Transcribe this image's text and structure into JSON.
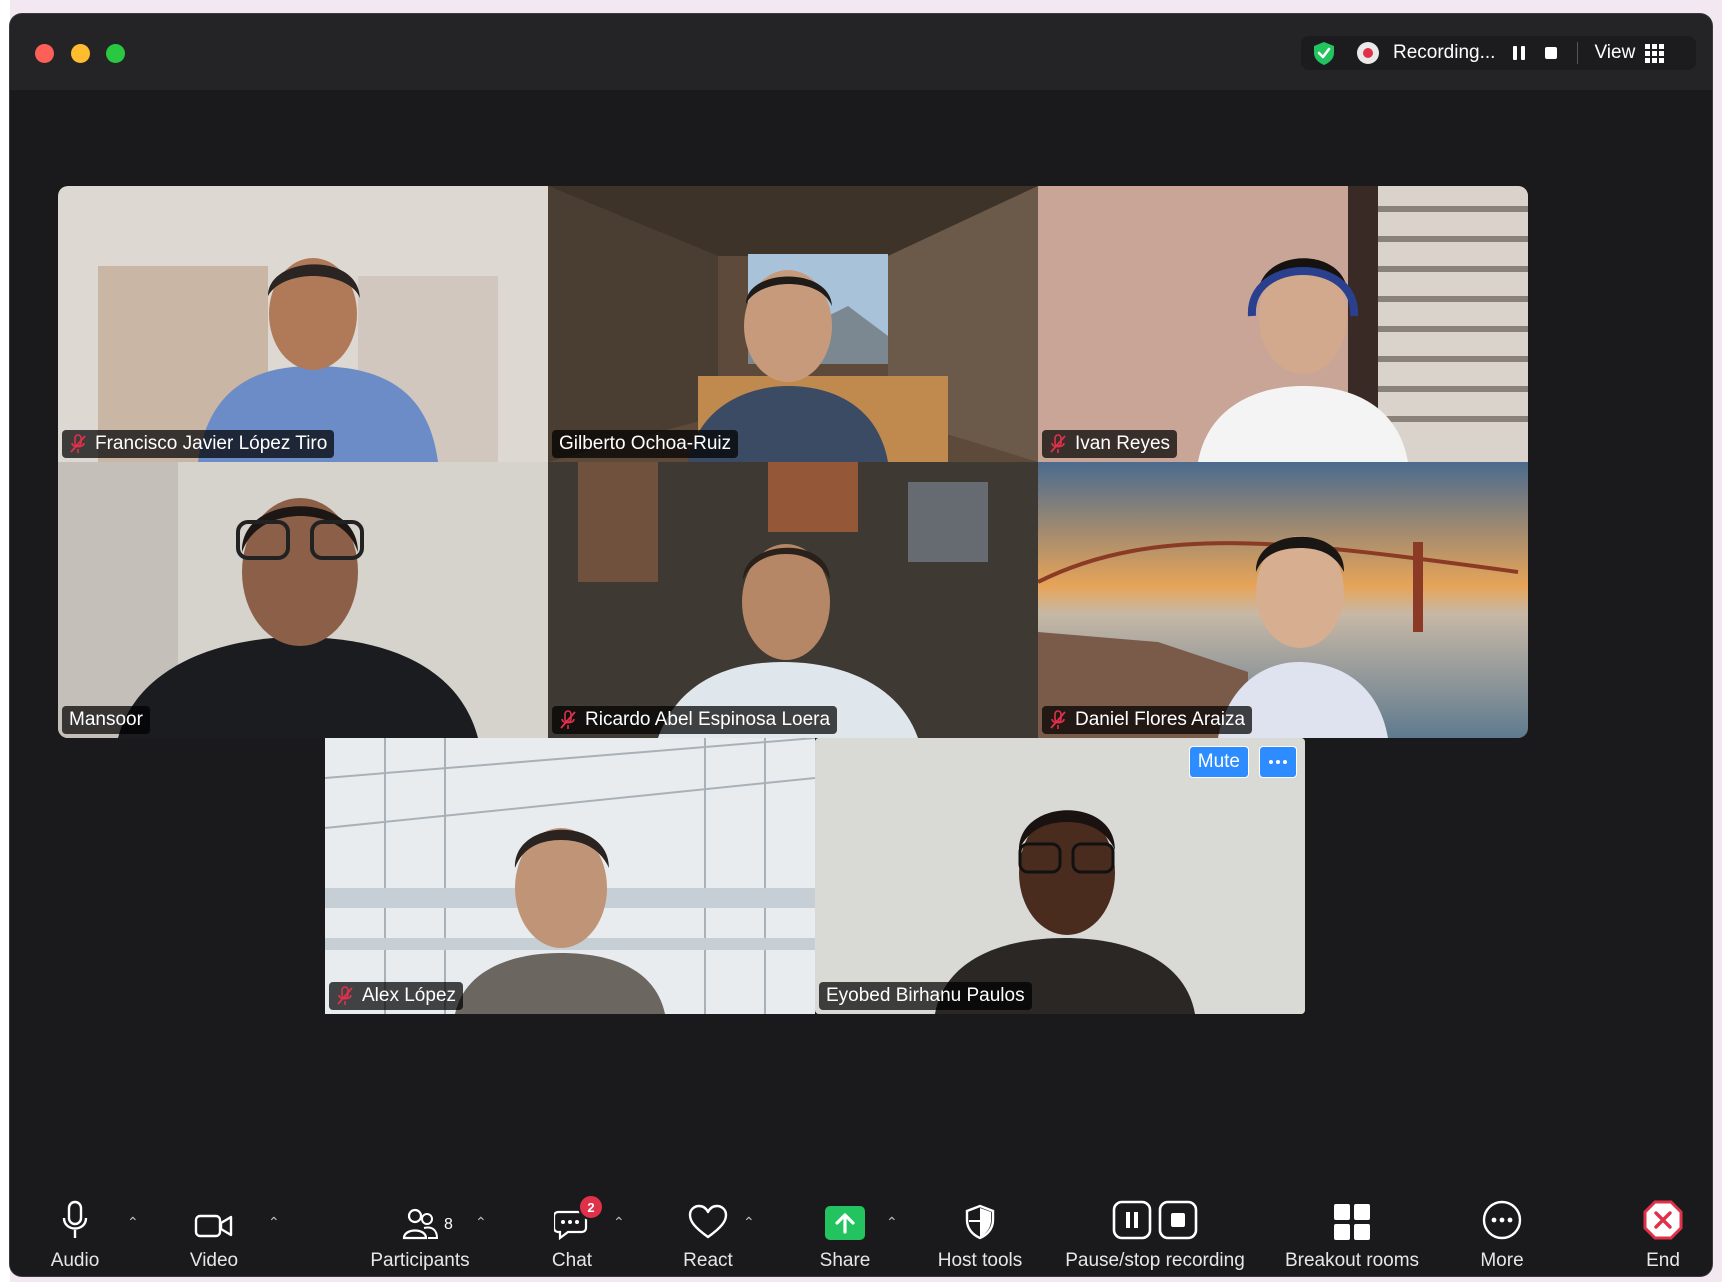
{
  "topbar": {
    "recording_label": "Recording...",
    "view_label": "View"
  },
  "participants": [
    {
      "name": "Francisco Javier López Tiro",
      "muted": true
    },
    {
      "name": "Gilberto Ochoa-Ruiz",
      "muted": false
    },
    {
      "name": "Ivan Reyes",
      "muted": true
    },
    {
      "name": "Mansoor",
      "muted": false
    },
    {
      "name": "Ricardo Abel Espinosa Loera",
      "muted": true
    },
    {
      "name": "Daniel Flores Araiza",
      "muted": true
    },
    {
      "name": "Alex López",
      "muted": true
    },
    {
      "name": "Eyobed Birhanu Paulos",
      "muted": false,
      "active_speaker": true
    }
  ],
  "active_tile": {
    "mute_label": "Mute"
  },
  "toolbar": {
    "audio": "Audio",
    "video": "Video",
    "participants": "Participants",
    "participants_count": "8",
    "chat": "Chat",
    "chat_badge": "2",
    "react": "React",
    "share": "Share",
    "host_tools": "Host tools",
    "pause_stop_recording": "Pause/stop recording",
    "breakout_rooms": "Breakout rooms",
    "more": "More",
    "end": "End"
  },
  "colors": {
    "accent_blue": "#2d8cff",
    "active_speaker_border": "#52c34f",
    "recording_red": "#e0314b",
    "share_green": "#23c35f",
    "end_red": "#e0314b"
  }
}
